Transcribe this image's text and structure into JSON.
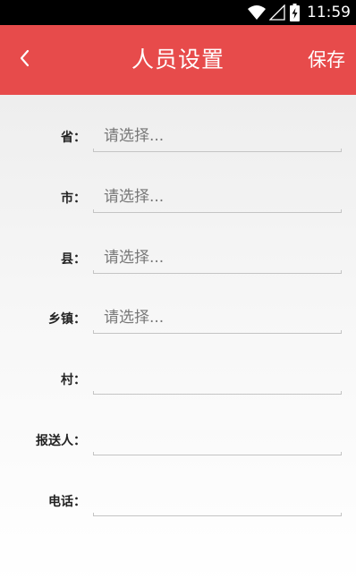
{
  "status_bar": {
    "time": "11:59",
    "icons": [
      "wifi-icon",
      "signal-icon",
      "battery-charging-icon"
    ]
  },
  "app_bar": {
    "back_icon": "chevron-left-icon",
    "title": "人员设置",
    "save_label": "保存",
    "color": "#e74b4b"
  },
  "form": {
    "rows": [
      {
        "label": "省：",
        "placeholder": "请选择...",
        "value": ""
      },
      {
        "label": "市：",
        "placeholder": "请选择...",
        "value": ""
      },
      {
        "label": "县：",
        "placeholder": "请选择...",
        "value": ""
      },
      {
        "label": "乡镇：",
        "placeholder": "请选择...",
        "value": ""
      },
      {
        "label": "村：",
        "placeholder": "",
        "value": ""
      },
      {
        "label": "报送人：",
        "placeholder": "",
        "value": ""
      },
      {
        "label": "电话：",
        "placeholder": "",
        "value": ""
      }
    ]
  }
}
